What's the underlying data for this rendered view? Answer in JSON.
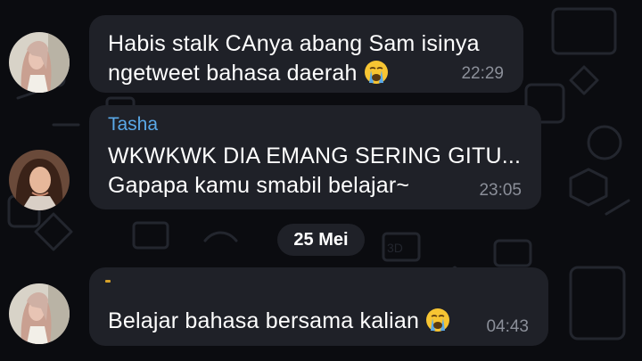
{
  "messages": [
    {
      "sender": "",
      "lines": [
        "Habis stalk CAnya abang Sam isinya",
        "ngetweet bahasa daerah"
      ],
      "emoji": "loudly-crying-face",
      "time": "22:29"
    },
    {
      "sender": "Tasha",
      "lines": [
        "WKWKWK DIA EMANG SERING GITU...",
        "Gapapa kamu smabil belajar~"
      ],
      "emoji": "",
      "time": "23:05"
    },
    {
      "sender": "",
      "lines": [
        "Belajar bahasa bersama kalian"
      ],
      "emoji": "loudly-crying-face",
      "time": "04:43"
    }
  ],
  "date_separator": "25 Mei",
  "colors": {
    "background": "#0b0c10",
    "bubble": "#1f2128",
    "sender_name": "#5aa9e8",
    "timestamp": "#8b8f99",
    "reply_accent": "#d6a12a"
  }
}
